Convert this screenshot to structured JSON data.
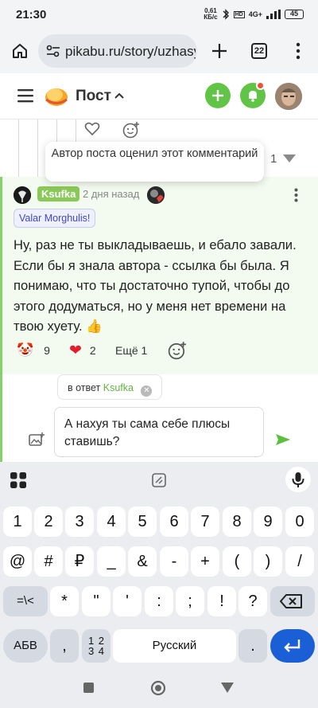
{
  "status_bar": {
    "time": "21:30",
    "net_speed_value": "0,61",
    "net_speed_unit": "КБ/с",
    "signal": "4G+",
    "battery": "45"
  },
  "browser": {
    "url": "pikabu.ru/story/uzhasy",
    "tab_count": "22"
  },
  "header": {
    "title": "Пост"
  },
  "tooltip": {
    "text": "Автор поста оценил этот комментарий"
  },
  "prev_comment": {
    "rating": "1"
  },
  "comment": {
    "author": "Ksufka",
    "time": "2 дня назад",
    "badge": "Valar Morghulis!",
    "text": "Ну, раз не ты выкладываешь, и ебало завали. Если бы я знала автора - ссылка бы была. Я понимаю, что ты достаточно тупой, чтобы до этого додуматься, но у меня нет времени на твою хуету. 👍",
    "reactions": [
      {
        "emoji": "🤡",
        "count": "9"
      },
      {
        "emoji": "❤",
        "count": "2"
      }
    ],
    "more_label": "Ещё 1"
  },
  "reply": {
    "prefix": "в ответ",
    "to": "Ksufka",
    "draft": "А нахуя ты сама себе плюсы ставишь?"
  },
  "keyboard": {
    "row1": [
      "1",
      "2",
      "3",
      "4",
      "5",
      "6",
      "7",
      "8",
      "9",
      "0"
    ],
    "row2": [
      "@",
      "#",
      "₽",
      "_",
      "&",
      "-",
      "+",
      "(",
      ")",
      "/"
    ],
    "row3": [
      "=\\<",
      "*",
      "\"",
      "'",
      ":",
      ";",
      "!",
      "?"
    ],
    "abc": "АБВ",
    "comma": ",",
    "numpad": "1 2 3 4",
    "space": "Русский",
    "period": "."
  },
  "colors": {
    "accent_green": "#8ac858",
    "send_blue": "#1a5fd6",
    "thread_border": "#83d36a",
    "notify_red": "#e8523b"
  }
}
